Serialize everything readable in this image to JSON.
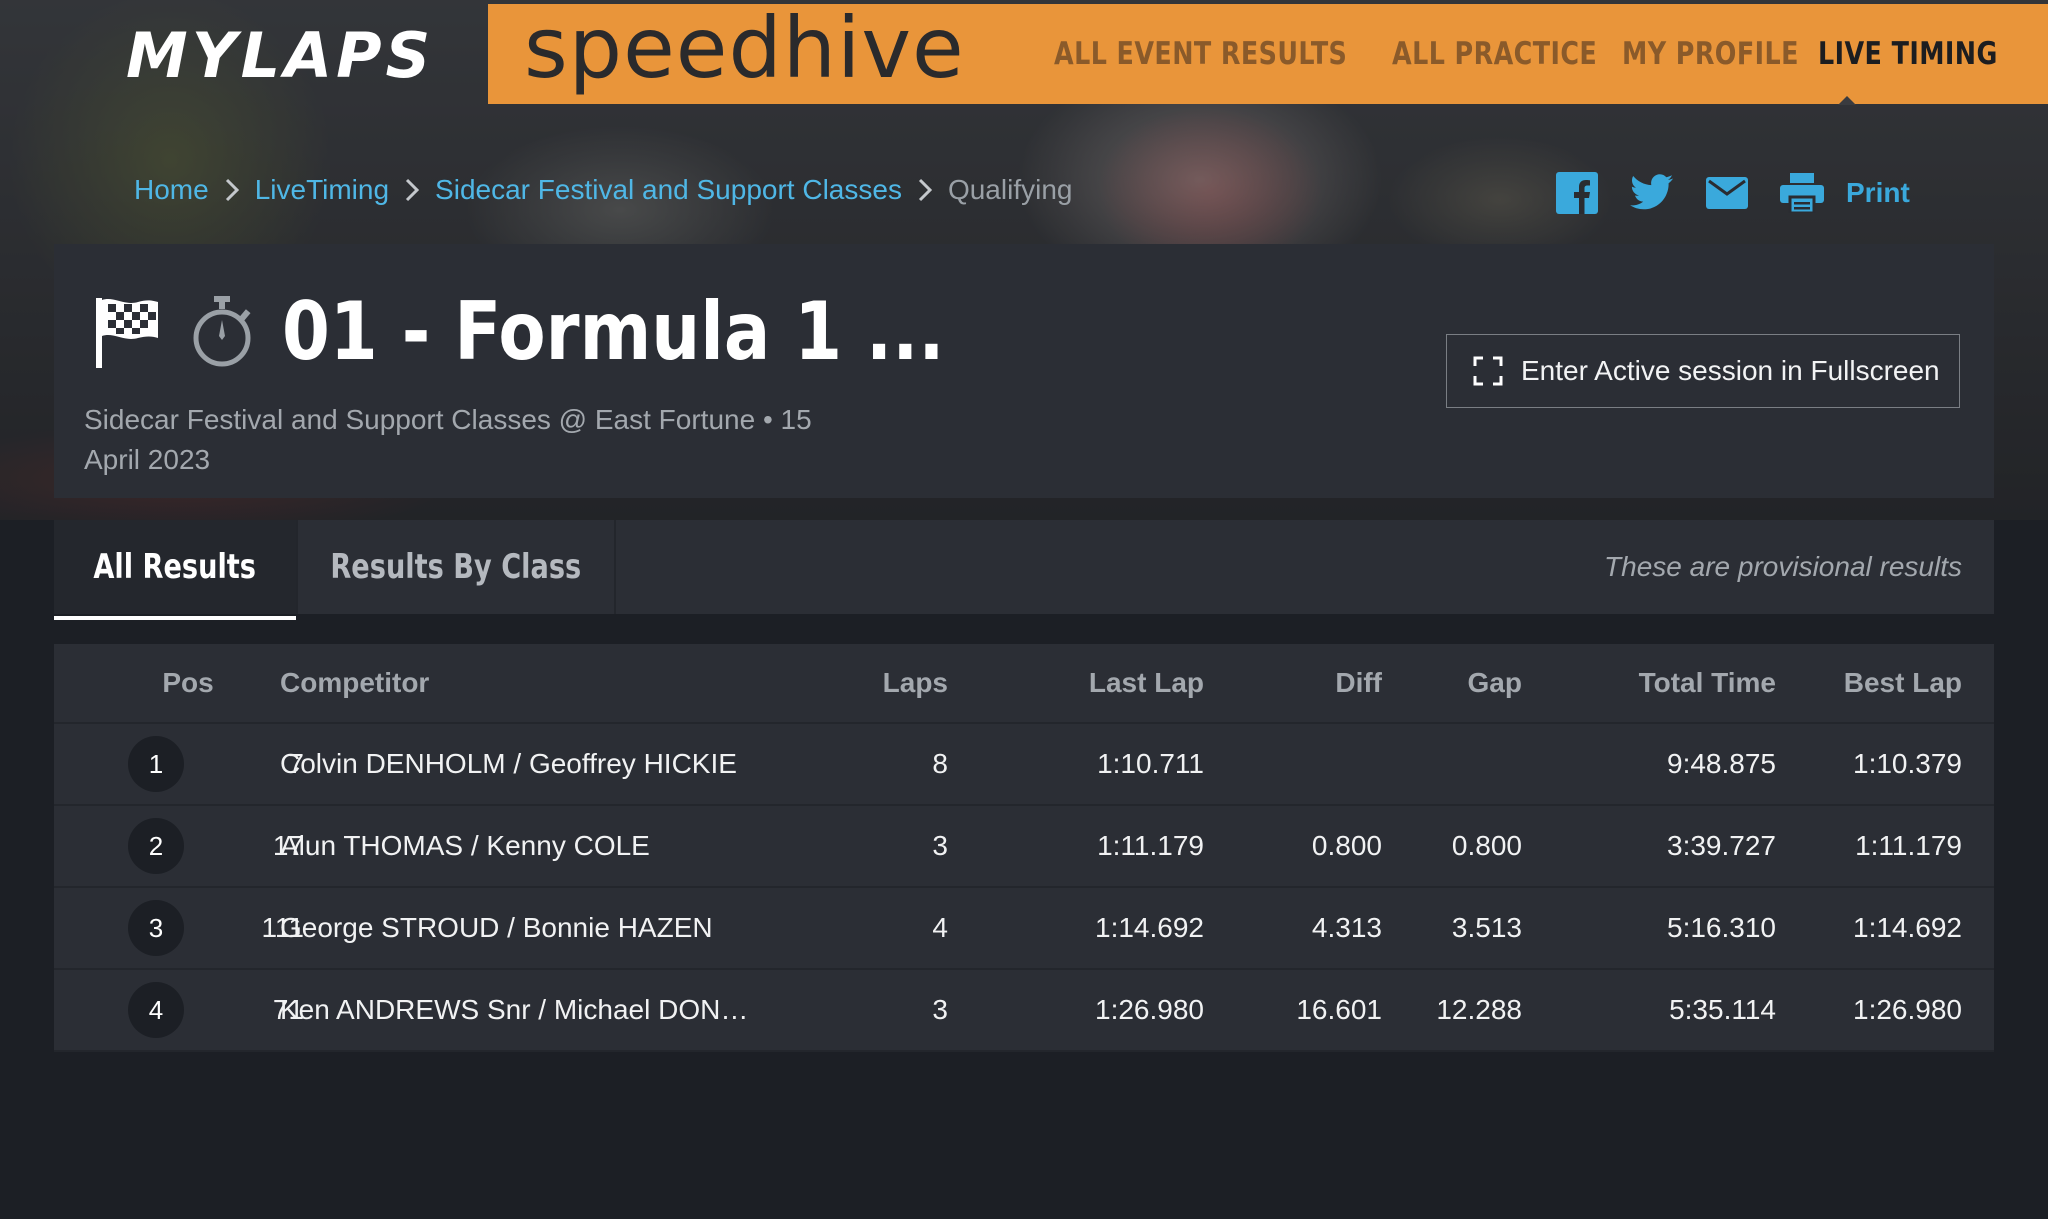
{
  "brand": {
    "mylaps": "MYLAPS",
    "speedhive": "speedhive"
  },
  "nav": {
    "items": [
      {
        "label": "ALL EVENT RESULTS"
      },
      {
        "label": "ALL PRACTICE"
      },
      {
        "label": "MY PROFILE"
      },
      {
        "label": "LIVE TIMING"
      }
    ],
    "active": "LIVE TIMING"
  },
  "breadcrumb": [
    "Home",
    "LiveTiming",
    "Sidecar Festival and Support Classes",
    "Qualifying"
  ],
  "share": {
    "print_label": "Print"
  },
  "session": {
    "title": "01 - Formula 1 ...",
    "subtitle": "Sidecar Festival and Support Classes @ East Fortune • 15 April 2023",
    "fullscreen_label": "Enter Active session in Fullscreen"
  },
  "tabs": {
    "all": "All Results",
    "by_class": "Results By Class",
    "note": "These are provisional results"
  },
  "table": {
    "headers": {
      "pos": "Pos",
      "competitor": "Competitor",
      "laps": "Laps",
      "last_lap": "Last Lap",
      "diff": "Diff",
      "gap": "Gap",
      "total_time": "Total Time",
      "best_lap": "Best Lap"
    },
    "rows": [
      {
        "pos": "1",
        "number": "7",
        "competitor": "Colvin DENHOLM / Geoffrey HICKIE",
        "laps": "8",
        "last_lap": "1:10.711",
        "diff": "",
        "gap": "",
        "total_time": "9:48.875",
        "best_lap": "1:10.379"
      },
      {
        "pos": "2",
        "number": "17",
        "competitor": "Alun THOMAS / Kenny COLE",
        "laps": "3",
        "last_lap": "1:11.179",
        "diff": "0.800",
        "gap": "0.800",
        "total_time": "3:39.727",
        "best_lap": "1:11.179"
      },
      {
        "pos": "3",
        "number": "111",
        "competitor": "George STROUD / Bonnie HAZEN",
        "laps": "4",
        "last_lap": "1:14.692",
        "diff": "4.313",
        "gap": "3.513",
        "total_time": "5:16.310",
        "best_lap": "1:14.692"
      },
      {
        "pos": "4",
        "number": "71",
        "competitor": "Ken ANDREWS Snr / Michael DON…",
        "laps": "3",
        "last_lap": "1:26.980",
        "diff": "16.601",
        "gap": "12.288",
        "total_time": "5:35.114",
        "best_lap": "1:26.980"
      }
    ]
  },
  "colors": {
    "accent_orange": "#e9953a",
    "link_blue": "#4fb7e6",
    "panel": "#2b2e35",
    "page_bg": "#1c1f25"
  },
  "icons": [
    "checkered-flag-icon",
    "stopwatch-icon",
    "facebook-icon",
    "twitter-icon",
    "mail-icon",
    "printer-icon",
    "fullscreen-icon",
    "chevron-right-icon"
  ]
}
